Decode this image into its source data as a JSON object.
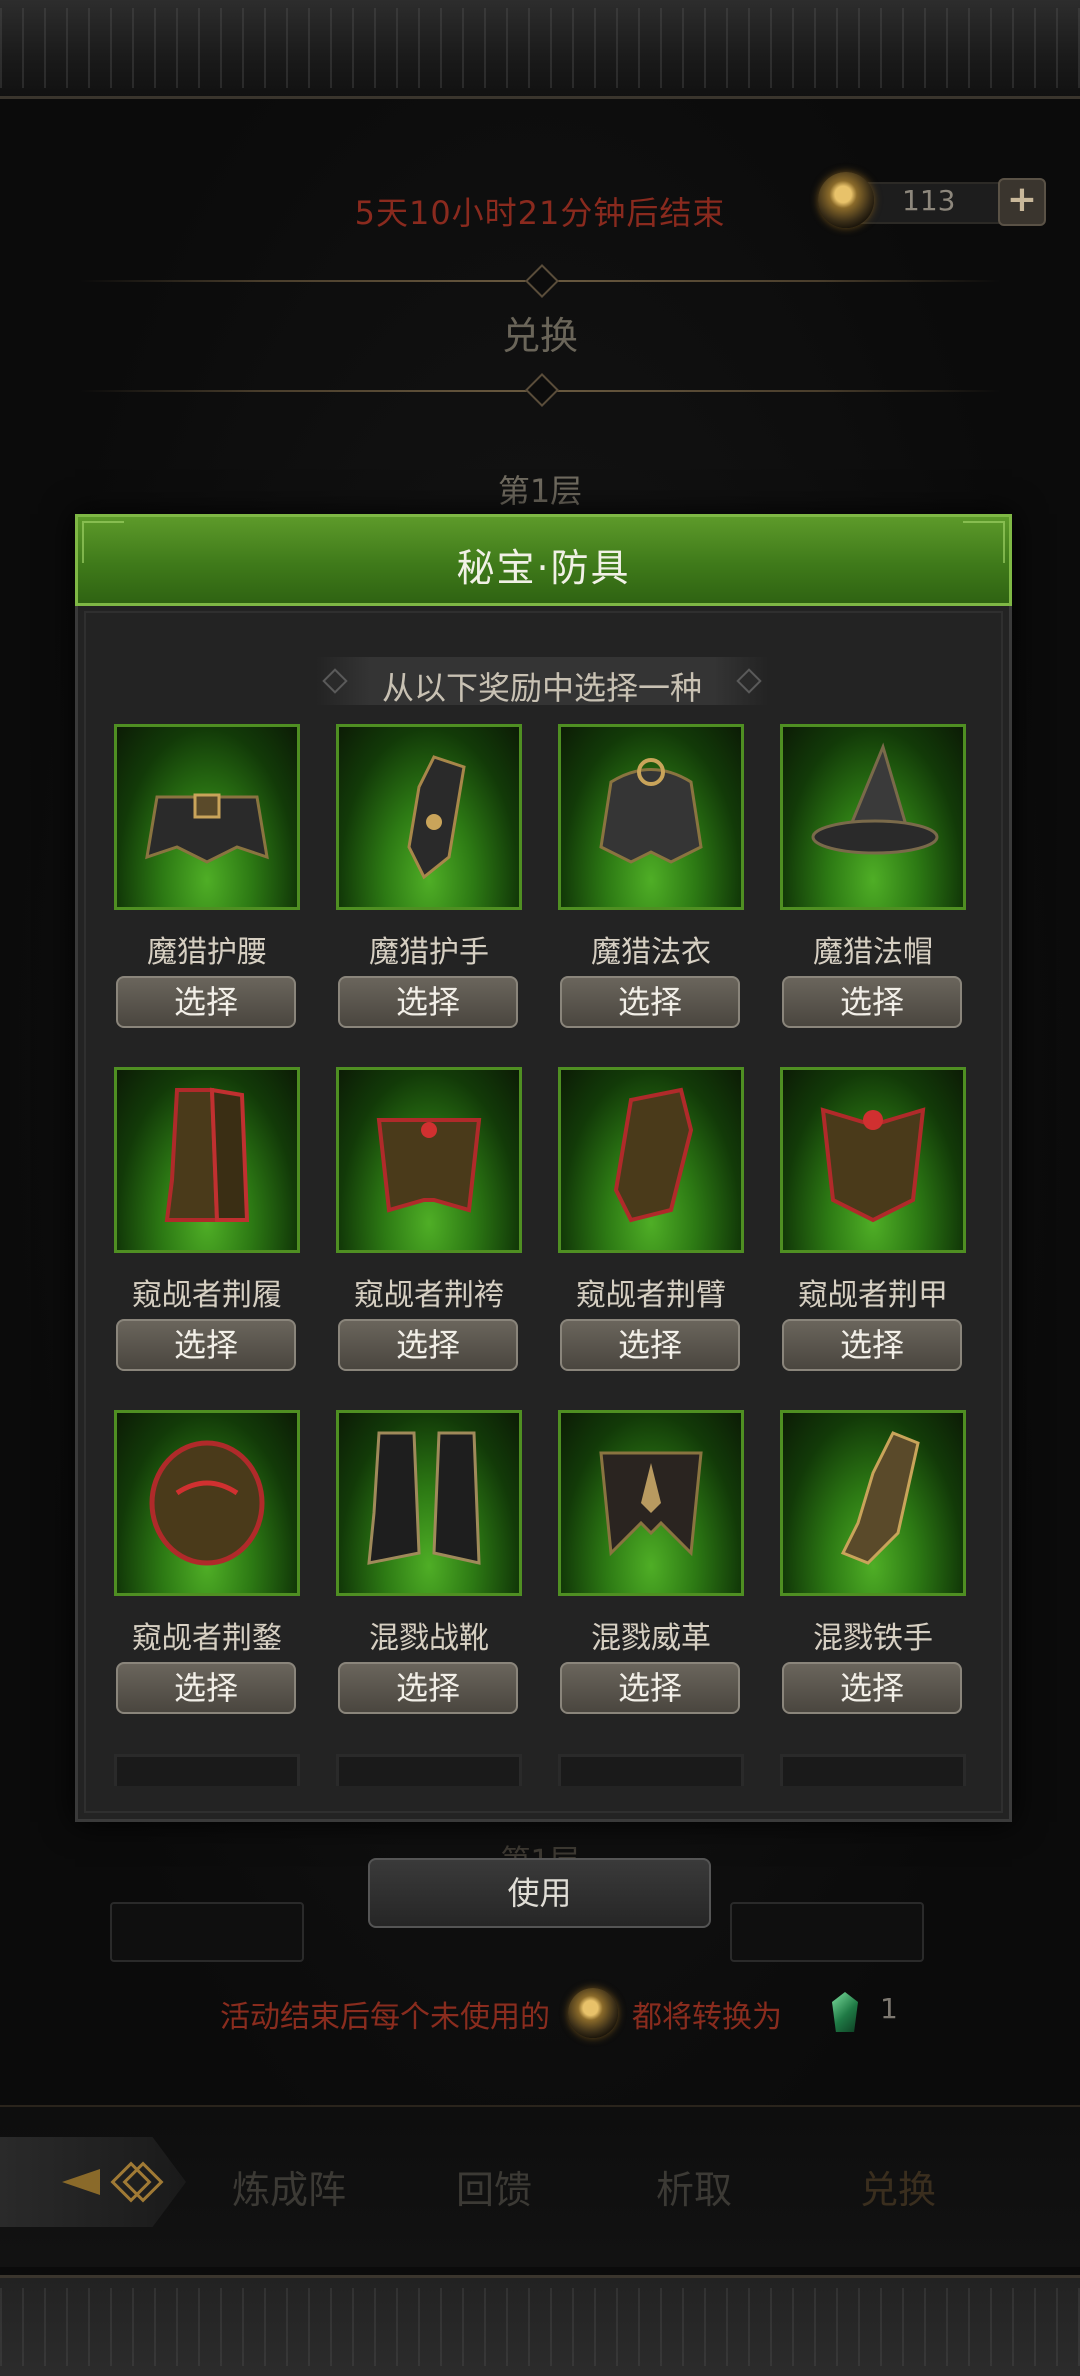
{
  "header": {
    "timer_text": "5天10小时21分钟后结束",
    "currency_amount": "113",
    "add_label": "+",
    "title": "兑换",
    "tier_label": "第1层"
  },
  "modal": {
    "title": "秘宝·防具",
    "subtitle": "从以下奖励中选择一种",
    "select_label": "选择",
    "items": [
      {
        "name": "魔猎护腰",
        "icon": "belt-icon"
      },
      {
        "name": "魔猎护手",
        "icon": "gauntlet-icon"
      },
      {
        "name": "魔猎法衣",
        "icon": "robe-icon"
      },
      {
        "name": "魔猎法帽",
        "icon": "wizard-hat-icon"
      },
      {
        "name": "窥觇者荆履",
        "icon": "thorn-boots-icon"
      },
      {
        "name": "窥觇者荆袴",
        "icon": "thorn-leggings-icon"
      },
      {
        "name": "窥觇者荆臂",
        "icon": "thorn-bracer-icon"
      },
      {
        "name": "窥觇者荆甲",
        "icon": "thorn-armor-icon"
      },
      {
        "name": "窥觇者荆鍪",
        "icon": "thorn-helm-icon"
      },
      {
        "name": "混戮战靴",
        "icon": "war-boots-icon"
      },
      {
        "name": "混戮威革",
        "icon": "leather-skirt-icon"
      },
      {
        "name": "混戮铁手",
        "icon": "iron-glove-icon"
      }
    ]
  },
  "behind_label": "第1层",
  "use_label": "使用",
  "note": {
    "prefix": "活动结束后每个未使用的",
    "suffix": "都将转换为",
    "count": "1"
  },
  "nav": {
    "tabs": [
      "炼成阵",
      "回馈",
      "析取",
      "兑换"
    ],
    "active": "兑换"
  },
  "colors": {
    "accent_green": "#4f8f22",
    "timer_red": "#8a2a1e"
  }
}
